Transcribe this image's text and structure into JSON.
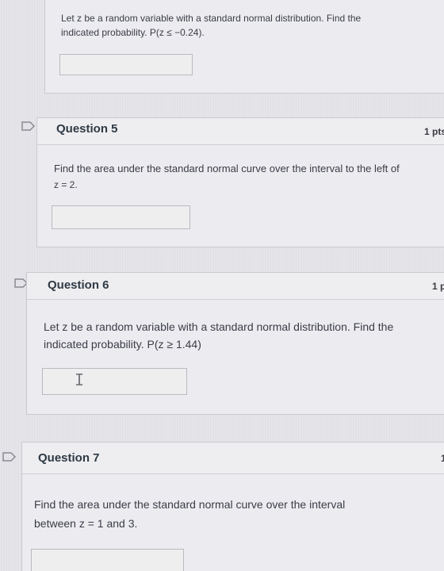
{
  "q4": {
    "text_line1": "Let z be a random variable with a standard normal distribution. Find the",
    "text_line2": "indicated probability. P(z ≤ −0.24)."
  },
  "q5": {
    "title": "Question 5",
    "points": "1 pts",
    "text_line1": "Find the area under the standard normal curve over the interval to the left of",
    "text_line2": "z = 2."
  },
  "q6": {
    "title": "Question 6",
    "points": "1 p",
    "text_line1": "Let z be a random variable with a standard normal distribution. Find the",
    "text_line2": "indicated probability. P(z ≥ 1.44)"
  },
  "q7": {
    "title": "Question 7",
    "points": "1",
    "text_line1": "Find the area under the standard normal curve over the interval",
    "text_line2": "between z = 1 and 3."
  },
  "icons": {
    "flag": "flag-icon",
    "cursor": "text-cursor-icon"
  },
  "colors": {
    "background": "#e6e6ea",
    "card": "#ececf0",
    "border": "#c9c9cf"
  }
}
